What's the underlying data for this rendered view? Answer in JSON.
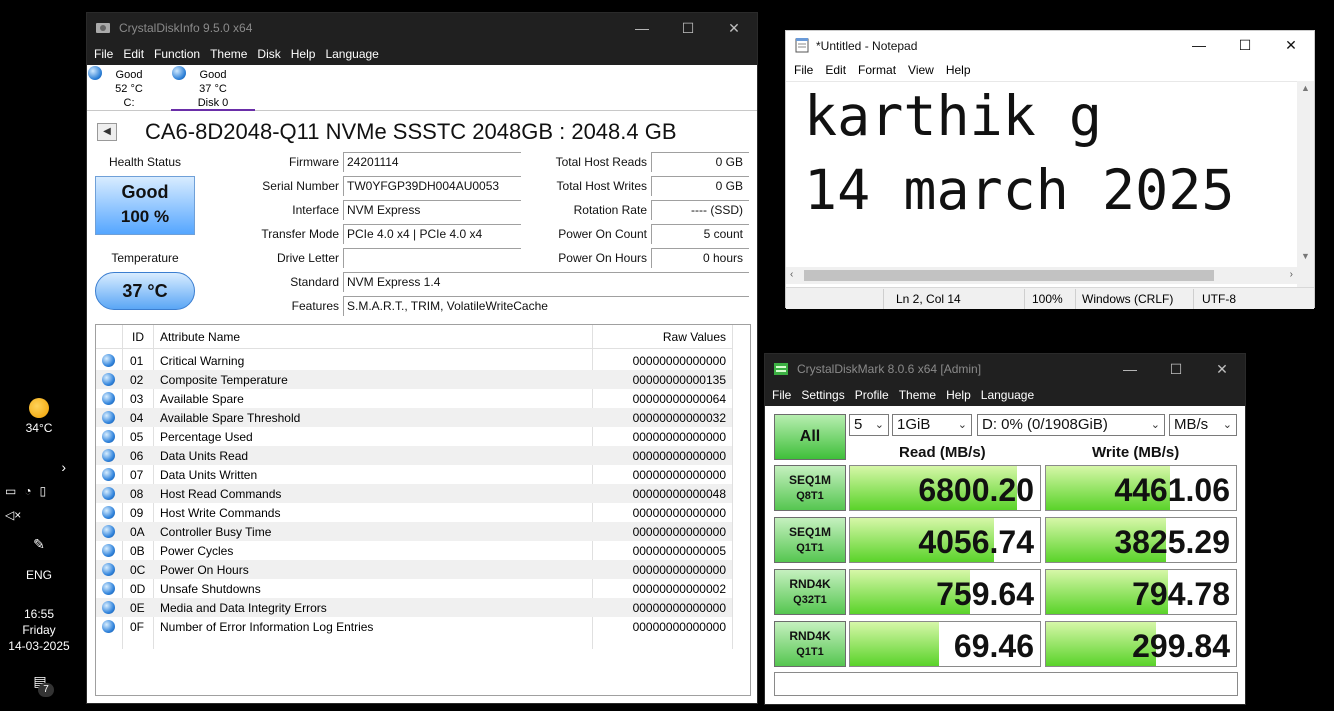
{
  "taskbar": {
    "weather_temp": "34°C",
    "language": "ENG",
    "time": "16:55",
    "day": "Friday",
    "date": "14-03-2025",
    "notification_count": "7"
  },
  "cdi": {
    "title": "CrystalDiskInfo 9.5.0 x64",
    "menu": [
      "File",
      "Edit",
      "Function",
      "Theme",
      "Disk",
      "Help",
      "Language"
    ],
    "disks": [
      {
        "status": "Good",
        "temp": "52 °C",
        "name": "C:"
      },
      {
        "status": "Good",
        "temp": "37 °C",
        "name": "Disk 0"
      }
    ],
    "model": "CA6-8D2048-Q11 NVMe SSSTC 2048GB : 2048.4 GB",
    "health_label": "Health Status",
    "health_status": "Good",
    "health_pct": "100 %",
    "temp_label": "Temperature",
    "temp_value": "37 °C",
    "left_fields": [
      {
        "label": "Firmware",
        "value": "24201114"
      },
      {
        "label": "Serial Number",
        "value": "TW0YFGP39DH004AU0053"
      },
      {
        "label": "Interface",
        "value": "NVM Express"
      },
      {
        "label": "Transfer Mode",
        "value": "PCIe 4.0 x4 | PCIe 4.0 x4"
      },
      {
        "label": "Drive Letter",
        "value": ""
      }
    ],
    "right_fields": [
      {
        "label": "Total Host Reads",
        "value": "0 GB"
      },
      {
        "label": "Total Host Writes",
        "value": "0 GB"
      },
      {
        "label": "Rotation Rate",
        "value": "---- (SSD)"
      },
      {
        "label": "Power On Count",
        "value": "5 count"
      },
      {
        "label": "Power On Hours",
        "value": "0 hours"
      }
    ],
    "standard_label": "Standard",
    "standard_value": "NVM Express 1.4",
    "features_label": "Features",
    "features_value": "S.M.A.R.T., TRIM, VolatileWriteCache",
    "smart_headers": {
      "id": "ID",
      "name": "Attribute Name",
      "raw": "Raw Values"
    },
    "smart_rows": [
      {
        "id": "01",
        "name": "Critical Warning",
        "raw": "00000000000000"
      },
      {
        "id": "02",
        "name": "Composite Temperature",
        "raw": "00000000000135"
      },
      {
        "id": "03",
        "name": "Available Spare",
        "raw": "00000000000064"
      },
      {
        "id": "04",
        "name": "Available Spare Threshold",
        "raw": "00000000000032"
      },
      {
        "id": "05",
        "name": "Percentage Used",
        "raw": "00000000000000"
      },
      {
        "id": "06",
        "name": "Data Units Read",
        "raw": "00000000000000"
      },
      {
        "id": "07",
        "name": "Data Units Written",
        "raw": "00000000000000"
      },
      {
        "id": "08",
        "name": "Host Read Commands",
        "raw": "00000000000048"
      },
      {
        "id": "09",
        "name": "Host Write Commands",
        "raw": "00000000000000"
      },
      {
        "id": "0A",
        "name": "Controller Busy Time",
        "raw": "00000000000000"
      },
      {
        "id": "0B",
        "name": "Power Cycles",
        "raw": "00000000000005"
      },
      {
        "id": "0C",
        "name": "Power On Hours",
        "raw": "00000000000000"
      },
      {
        "id": "0D",
        "name": "Unsafe Shutdowns",
        "raw": "00000000000002"
      },
      {
        "id": "0E",
        "name": "Media and Data Integrity Errors",
        "raw": "00000000000000"
      },
      {
        "id": "0F",
        "name": "Number of Error Information Log Entries",
        "raw": "00000000000000"
      }
    ]
  },
  "notepad": {
    "title": "*Untitled - Notepad",
    "menu": [
      "File",
      "Edit",
      "Format",
      "View",
      "Help"
    ],
    "lines": [
      "karthik g",
      "14 march 2025"
    ],
    "status": {
      "position": "Ln 2, Col 14",
      "zoom": "100%",
      "eol": "Windows (CRLF)",
      "encoding": "UTF-8"
    }
  },
  "cdm": {
    "title": "CrystalDiskMark 8.0.6 x64 [Admin]",
    "menu": [
      "File",
      "Settings",
      "Profile",
      "Theme",
      "Help",
      "Language"
    ],
    "all_label": "All",
    "count": "5",
    "size": "1GiB",
    "drive": "D: 0% (0/1908GiB)",
    "unit": "MB/s",
    "read_header": "Read (MB/s)",
    "write_header": "Write (MB/s)",
    "tests": [
      {
        "name": "SEQ1M",
        "sub": "Q8T1",
        "read": "6800.20",
        "write": "4461.06",
        "read_fill": 0.88,
        "write_fill": 0.65
      },
      {
        "name": "SEQ1M",
        "sub": "Q1T1",
        "read": "4056.74",
        "write": "3825.29",
        "read_fill": 0.76,
        "write_fill": 0.63
      },
      {
        "name": "RND4K",
        "sub": "Q32T1",
        "read": "759.64",
        "write": "794.78",
        "read_fill": 0.63,
        "write_fill": 0.64
      },
      {
        "name": "RND4K",
        "sub": "Q1T1",
        "read": "69.46",
        "write": "299.84",
        "read_fill": 0.47,
        "write_fill": 0.58
      }
    ]
  }
}
